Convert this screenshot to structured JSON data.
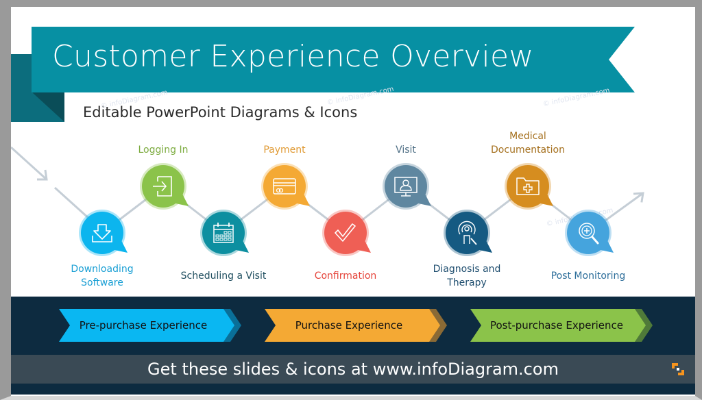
{
  "header": {
    "title": "Customer Experience Overview",
    "subtitle": "Editable PowerPoint Diagrams & Icons",
    "ribbon_color": "#0790a3",
    "ribbon_dark_color": "#0c6d7d",
    "fold_color": "#0a4d58"
  },
  "watermark": "© infoDiagram.com",
  "steps": [
    {
      "label": "Downloading Software",
      "lines": [
        "Downloading",
        "Software"
      ],
      "icon": "download-icon",
      "color": "#0cb5ee",
      "label_color": "#1a9fd4",
      "position": "low"
    },
    {
      "label": "Logging In",
      "lines": [
        "Logging In"
      ],
      "icon": "login-icon",
      "color": "#8bc34a",
      "label_color": "#7cab3f",
      "position": "high"
    },
    {
      "label": "Scheduling a Visit",
      "lines": [
        "Scheduling a Visit"
      ],
      "icon": "calendar-icon",
      "color": "#0d8fa0",
      "label_color": "#1f4e5f",
      "position": "low"
    },
    {
      "label": "Payment",
      "lines": [
        "Payment"
      ],
      "icon": "credit-card-icon",
      "color": "#f4a934",
      "label_color": "#e09a34",
      "position": "high"
    },
    {
      "label": "Confirmation",
      "lines": [
        "Confirmation"
      ],
      "icon": "checkmark-icon",
      "color": "#ef5f55",
      "label_color": "#e5443a",
      "position": "low"
    },
    {
      "label": "Visit",
      "lines": [
        "Visit"
      ],
      "icon": "monitor-user-icon",
      "color": "#5f87a0",
      "label_color": "#4f6f85",
      "position": "high"
    },
    {
      "label": "Diagnosis and Therapy",
      "lines": [
        "Diagnosis and",
        "Therapy"
      ],
      "icon": "diagnosis-icon",
      "color": "#155a82",
      "label_color": "#1f4e6f",
      "position": "low"
    },
    {
      "label": "Medical Documentation",
      "lines": [
        "Medical",
        "Documentation"
      ],
      "icon": "medical-folder-icon",
      "color": "#d68d1f",
      "label_color": "#a5701e",
      "position": "high"
    },
    {
      "label": "Post Monitoring",
      "lines": [
        "Post Monitoring"
      ],
      "icon": "magnifier-plus-icon",
      "color": "#45a4dd",
      "label_color": "#2d6e9a",
      "position": "low"
    }
  ],
  "phases": [
    {
      "label": "Pre-purchase Experience",
      "color": "#0ab7f2",
      "shadow": "#0a6f98"
    },
    {
      "label": "Purchase Experience",
      "color": "#f4a934",
      "shadow": "#8a6a35"
    },
    {
      "label": "Post-purchase Experience",
      "color": "#8bc34a",
      "shadow": "#4f7a39"
    }
  ],
  "footer": {
    "text": "Get these slides & icons at www.infoDiagram.com",
    "logo_color": "#f7941d"
  },
  "path_color": "#c5ced6"
}
